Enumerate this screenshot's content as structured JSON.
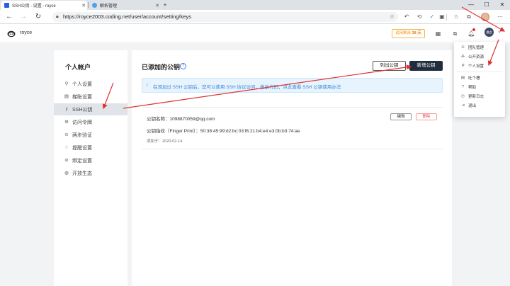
{
  "browser": {
    "tabs": [
      {
        "title": "SSH公钥 - 设置 - royce",
        "active": true
      },
      {
        "title": "解析管理",
        "active": false
      }
    ],
    "new_tab_label": "+",
    "window_controls": {
      "minimize": "—",
      "maximize": "☐",
      "close": "✕"
    },
    "url": "https://royce2003.coding.net/user/account/setting/keys"
  },
  "header": {
    "username": "royce",
    "trial_prefix": "试用剩余",
    "trial_days": "38 天",
    "avatar_text": "晨会"
  },
  "sidebar": {
    "title": "个人帐户",
    "items": [
      {
        "label": "个人设置",
        "icon": "person-icon"
      },
      {
        "label": "梯账设置",
        "icon": "card-icon"
      },
      {
        "label": "SSH公钥",
        "icon": "key-icon",
        "active": true
      },
      {
        "label": "访问令牌",
        "icon": "token-icon"
      },
      {
        "label": "两步验证",
        "icon": "shield-icon"
      },
      {
        "label": "提醒设置",
        "icon": "bell-icon"
      },
      {
        "label": "绑定设置",
        "icon": "link-icon"
      },
      {
        "label": "开放生态",
        "icon": "globe-icon"
      }
    ]
  },
  "main": {
    "title": "已添加的公钥",
    "help_glyph": "?",
    "list_button": "列出公钥",
    "add_button": "新增公钥",
    "notice": "在添加过 SSH 公钥后，您可以使用 SSH 协议访问，推送代码，点此查看 SSH 公钥使用办法",
    "key": {
      "name_label": "公钥名称：",
      "name_value": "1098870059@qq.com",
      "fingerprint_label": "公钥指纹（Finger Print）：",
      "fingerprint_value": "50:38:45:99:d2:bc:03:f6:21:b4:e4:e3:0b:b3:74:ae",
      "date_label": "添加于：",
      "date_value": "2020-02-14",
      "edit_button": "编辑",
      "delete_button": "删除"
    }
  },
  "dropdown": {
    "items": [
      {
        "label": "团队管理",
        "icon": "team-icon"
      },
      {
        "label": "公开资源",
        "icon": "share-icon"
      },
      {
        "label": "个人设置",
        "icon": "person-icon"
      },
      {
        "label": "吐个槽",
        "icon": "feedback-icon"
      },
      {
        "label": "帮助",
        "icon": "help-icon"
      },
      {
        "label": "更新日志",
        "icon": "log-icon"
      },
      {
        "label": "退出",
        "icon": "logout-icon"
      }
    ]
  },
  "colors": {
    "annotation": "#e03131",
    "primary_dark": "#1f2d3d",
    "notice_text": "#3a86d9",
    "trial_orange": "#f29000"
  }
}
